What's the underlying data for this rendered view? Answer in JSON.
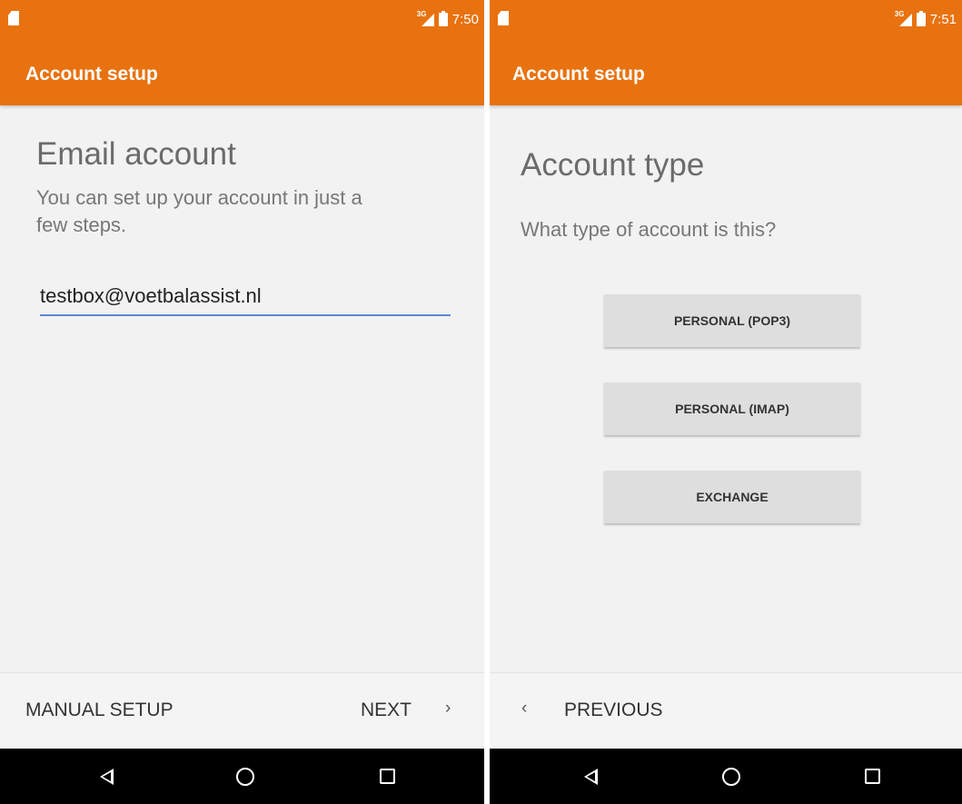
{
  "left": {
    "status": {
      "time": "7:50",
      "network": "3G"
    },
    "appbar": {
      "title": "Account setup"
    },
    "heading": "Email account",
    "subtext_line1": "You can set up your account in just a",
    "subtext_line2": "few steps.",
    "email": {
      "value": "testbox@voetbalassist.nl"
    },
    "actions": {
      "manual_setup": "MANUAL SETUP",
      "next": "NEXT",
      "next_chevron": "›"
    }
  },
  "right": {
    "status": {
      "time": "7:51",
      "network": "3G"
    },
    "appbar": {
      "title": "Account setup"
    },
    "heading": "Account type",
    "question": "What type of account is this?",
    "options": [
      "PERSONAL (POP3)",
      "PERSONAL (IMAP)",
      "EXCHANGE"
    ],
    "actions": {
      "previous": "PREVIOUS",
      "previous_chevron": "‹"
    }
  },
  "colors": {
    "accent": "#e8720f",
    "input_underline": "#5c86d6",
    "background": "#f2f2f2",
    "navbar": "#000000"
  },
  "icons": [
    "sim-card-icon",
    "signal-icon",
    "battery-icon",
    "back-icon",
    "home-icon",
    "recents-icon"
  ]
}
